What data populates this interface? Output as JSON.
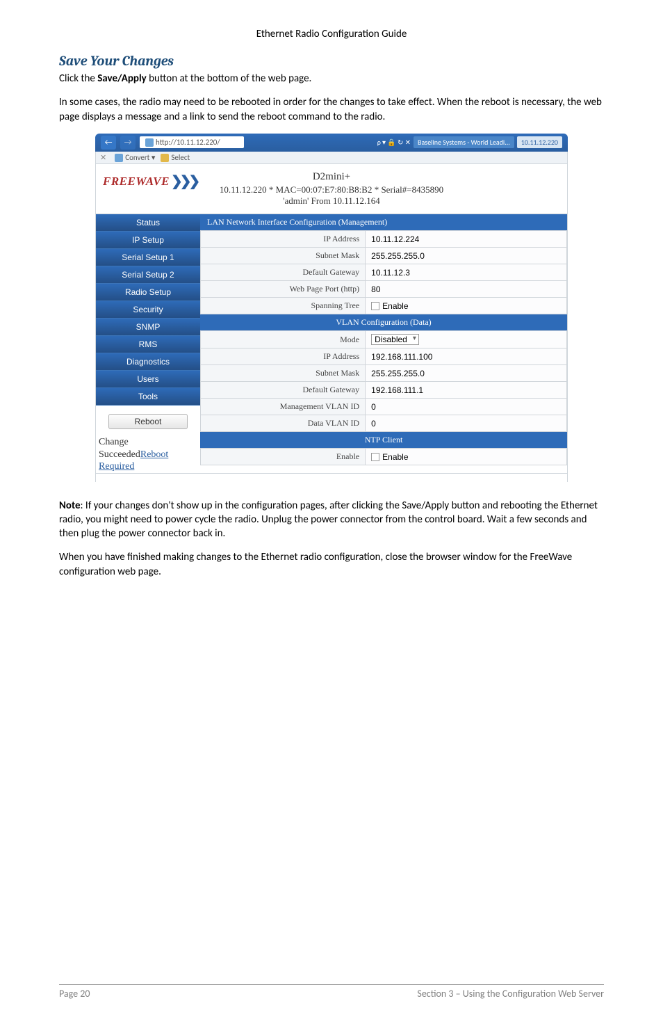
{
  "header": {
    "title": "Ethernet Radio Configuration Guide"
  },
  "section": {
    "title": "Save Your Changes",
    "p1_a": "Click the ",
    "p1_b": "Save/Apply",
    "p1_c": " button at the bottom of the web page.",
    "p2": "In some cases, the radio may need to be rebooted in order for the changes to take effect. When the reboot is necessary, the web page displays a message and a link to send the reboot command to the radio."
  },
  "browser": {
    "url": "http://10.11.12.220/",
    "search_hint": "ρ ▾ 🔒 ↻ ✕",
    "tab1": "Baseline Systems - World Leadi...",
    "tab2": "10.11.12.220",
    "toolbar_close": "✕",
    "toolbar_convert": "Convert",
    "toolbar_select": "Select"
  },
  "logo": {
    "text": "FREEWAVE",
    "chev": "❯❯❯"
  },
  "banner": {
    "model": "D2mini+",
    "line2": "10.11.12.220 * MAC=00:07:E7:80:B8:B2 * Serial#=8435890",
    "line3": "'admin' From 10.11.12.164"
  },
  "sidebar": {
    "items": [
      "Status",
      "IP Setup",
      "Serial Setup 1",
      "Serial Setup 2",
      "Radio Setup",
      "Security",
      "SNMP",
      "RMS",
      "Diagnostics",
      "Users",
      "Tools"
    ],
    "reboot": "Reboot"
  },
  "callout": {
    "l1": "Change",
    "l2a": "Succeeded",
    "l2b": "Reboot",
    "l3": "Required"
  },
  "sections": {
    "lan": "LAN Network Interface Configuration (Management)",
    "vlan": "VLAN Configuration (Data)",
    "ntp": "NTP Client"
  },
  "lan": {
    "ip_label": "IP Address",
    "ip": "10.11.12.224",
    "mask_label": "Subnet Mask",
    "mask": "255.255.255.0",
    "gw_label": "Default Gateway",
    "gw": "10.11.12.3",
    "port_label": "Web Page Port (http)",
    "port": "80",
    "span_label": "Spanning Tree",
    "span": "Enable"
  },
  "vlan": {
    "mode_label": "Mode",
    "mode": "Disabled",
    "ip_label": "IP Address",
    "ip": "192.168.111.100",
    "mask_label": "Subnet Mask",
    "mask": "255.255.255.0",
    "gw_label": "Default Gateway",
    "gw": "192.168.111.1",
    "mgmt_label": "Management VLAN ID",
    "mgmt": "0",
    "data_label": "Data VLAN ID",
    "data": "0"
  },
  "ntp": {
    "en_label": "Enable",
    "en": "Enable"
  },
  "after": {
    "note_label": "Note",
    "note_body": ": If your changes don't show up in the configuration pages, after clicking the Save/Apply button and rebooting the Ethernet radio, you might need to power cycle the radio. Unplug the power connector from the control board. Wait a few seconds and then plug the power connector back in.",
    "p2": "When you have finished making changes to the Ethernet radio configuration, close the browser window for the FreeWave configuration web page."
  },
  "footer": {
    "left": "Page 20",
    "right": "Section 3 – Using the Configuration Web Server"
  }
}
